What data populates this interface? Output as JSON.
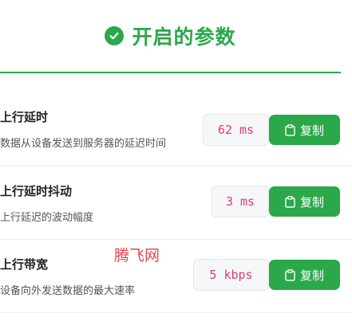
{
  "header": {
    "title": "开启的参数",
    "icon": "check-circle-icon",
    "accent": "#2aa84a"
  },
  "params": [
    {
      "label": "上行延时",
      "desc": "数据从设备发送到服务器的延迟时间",
      "value": "62 ms",
      "button": "复制"
    },
    {
      "label": "上行延时抖动",
      "desc": "上行延迟的波动幅度",
      "value": "3 ms",
      "button": "复制"
    },
    {
      "label": "上行带宽",
      "desc": "设备向外发送数据的最大速率",
      "value": "5 kbps",
      "button": "复制"
    }
  ],
  "watermark": "腾飞网",
  "colors": {
    "value_text": "#e23a6e",
    "button_bg": "#2aa84a"
  }
}
